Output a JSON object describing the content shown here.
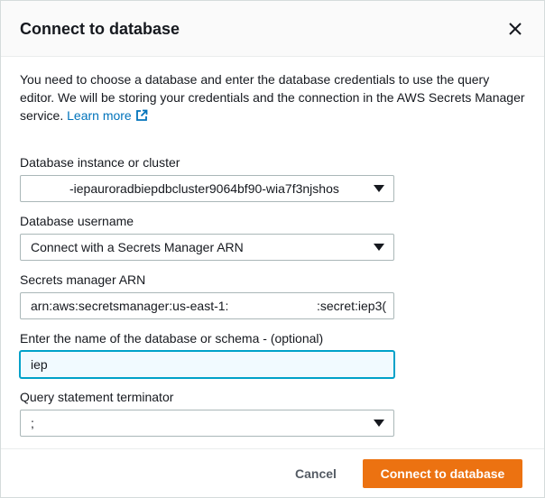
{
  "dialog": {
    "title": "Connect to database",
    "description": "You need to choose a database and enter the database credentials to use the query editor. We will be storing your credentials and the connection in the AWS Secrets Manager service.",
    "learn_more": "Learn more"
  },
  "form": {
    "instance": {
      "label": "Database instance or cluster",
      "value": "-iepauroradbiepdbcluster9064bf90-wia7f3njshos"
    },
    "username": {
      "label": "Database username",
      "value": "Connect with a Secrets Manager ARN"
    },
    "arn": {
      "label": "Secrets manager ARN",
      "value_prefix": "arn:aws:secretsmanager:us-east-1:",
      "value_suffix": ":secret:iep3("
    },
    "schema": {
      "label": "Enter the name of the database or schema - (optional)",
      "value": "iep"
    },
    "terminator": {
      "label": "Query statement terminator",
      "value": ";"
    }
  },
  "footer": {
    "cancel_label": "Cancel",
    "connect_label": "Connect to database"
  },
  "colors": {
    "primary_button": "#ec7211",
    "link": "#0073bb",
    "focus_border": "#00a1c9"
  },
  "icons": {
    "close": "close-icon",
    "external_link": "external-link-icon",
    "dropdown": "caret-down-icon"
  }
}
